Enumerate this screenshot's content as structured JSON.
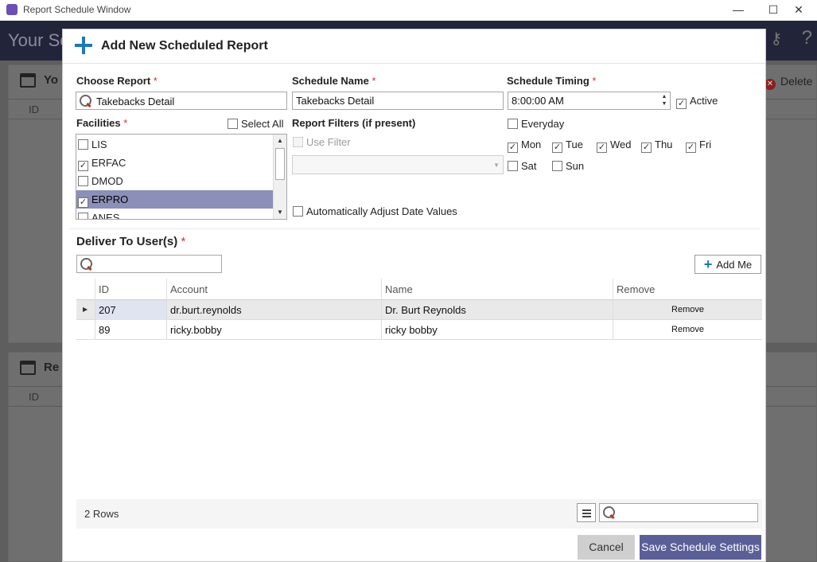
{
  "window": {
    "title": "Report Schedule Window",
    "minimize": "—",
    "maximize": "☐",
    "close": "✕"
  },
  "background": {
    "header_title": "Your Sc",
    "panel1_title": "Yo",
    "panel2_title": "Re",
    "grid_id_header": "ID",
    "delete_label": "Delete",
    "help": "?"
  },
  "modal": {
    "title": "Add New Scheduled Report",
    "choose_report": {
      "label": "Choose Report",
      "required": "*",
      "value": "Takebacks Detail"
    },
    "schedule_name": {
      "label": "Schedule Name",
      "required": "*",
      "value": "Takebacks Detail"
    },
    "schedule_timing": {
      "label": "Schedule Timing",
      "required": "*",
      "time": "8:00:00 AM",
      "active_label": "Active",
      "active_checked": true,
      "everyday_label": "Everyday",
      "everyday_checked": false,
      "days": [
        {
          "label": "Mon",
          "checked": true
        },
        {
          "label": "Tue",
          "checked": true
        },
        {
          "label": "Wed",
          "checked": true
        },
        {
          "label": "Thu",
          "checked": true
        },
        {
          "label": "Fri",
          "checked": true
        },
        {
          "label": "Sat",
          "checked": false
        },
        {
          "label": "Sun",
          "checked": false
        }
      ]
    },
    "facilities": {
      "label": "Facilities",
      "required": "*",
      "select_all_label": "Select All",
      "items": [
        {
          "label": "LIS",
          "checked": false,
          "selected": false
        },
        {
          "label": "ERFAC",
          "checked": true,
          "selected": false
        },
        {
          "label": "DMOD",
          "checked": false,
          "selected": false
        },
        {
          "label": "ERPRO",
          "checked": true,
          "selected": true
        },
        {
          "label": "ANES",
          "checked": false,
          "selected": false
        }
      ]
    },
    "report_filters": {
      "label": "Report Filters (if present)",
      "use_filter_label": "Use Filter",
      "auto_adjust_label": "Automatically Adjust Date Values"
    },
    "deliver": {
      "label": "Deliver To User(s)",
      "required": "*",
      "add_me_label": "Add Me",
      "columns": [
        "ID",
        "Account",
        "Name",
        "Remove"
      ],
      "rows": [
        {
          "id": "207",
          "account": "dr.burt.reynolds",
          "name": "Dr. Burt Reynolds",
          "remove": "Remove"
        },
        {
          "id": "89",
          "account": "ricky.bobby",
          "name": "ricky bobby",
          "remove": "Remove"
        }
      ],
      "row_count": "2 Rows"
    },
    "buttons": {
      "cancel": "Cancel",
      "save": "Save Schedule Settings"
    }
  },
  "colors": {
    "accent": "#1e77b7",
    "save_button": "#5b5f97",
    "selected_row": "#8c8fb7",
    "required": "#d23434"
  }
}
